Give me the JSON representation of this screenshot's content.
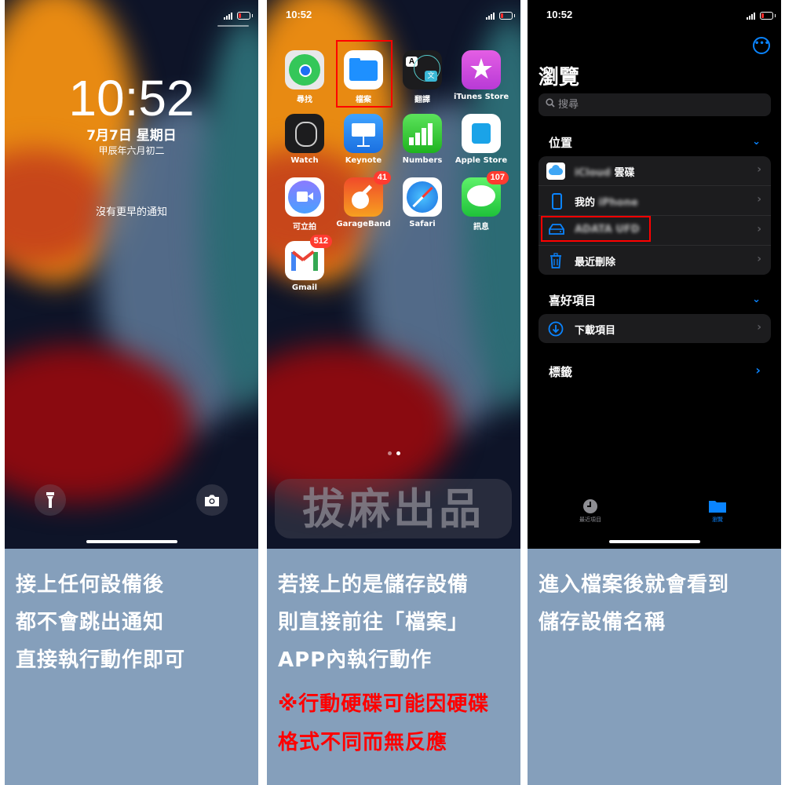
{
  "panels": [
    {
      "id": "lock-screen",
      "lock": {
        "time": "10:52",
        "date": "7月7日 星期日",
        "lunar_date": "甲辰年六月初二",
        "notification_text": "沒有更早的通知",
        "flashlight_icon": "flashlight-icon",
        "camera_icon": "camera-icon"
      },
      "caption": [
        "接上任何設備後",
        "都不會跳出通知",
        "直接執行動作即可"
      ]
    },
    {
      "id": "home-screen",
      "status_time": "10:52",
      "apps": [
        {
          "label": "尋找",
          "icon": "find-my-icon"
        },
        {
          "label": "檔案",
          "icon": "files-icon",
          "highlighted": true
        },
        {
          "label": "翻譯",
          "icon": "translate-icon"
        },
        {
          "label": "iTunes Store",
          "icon": "itunes-star-icon"
        },
        {
          "label": "Watch",
          "icon": "watch-icon"
        },
        {
          "label": "Keynote",
          "icon": "keynote-icon"
        },
        {
          "label": "Numbers",
          "icon": "numbers-icon"
        },
        {
          "label": "Apple Store",
          "icon": "apple-store-icon"
        },
        {
          "label": "可立拍",
          "icon": "clips-icon"
        },
        {
          "label": "GarageBand",
          "icon": "garageband-icon",
          "badge": "41"
        },
        {
          "label": "Safari",
          "icon": "safari-icon"
        },
        {
          "label": "訊息",
          "icon": "messages-icon",
          "badge": "107"
        },
        {
          "label": "Gmail",
          "icon": "gmail-icon",
          "badge": "512"
        }
      ],
      "page_dots": {
        "count": 2,
        "active": 2
      },
      "watermark": "拔麻出品",
      "caption": [
        "若接上的是儲存設備",
        "則直接前往「檔案」",
        "APP內執行動作"
      ],
      "caption_warning": [
        "※行動硬碟可能因硬碟",
        "格式不同而無反應"
      ]
    },
    {
      "id": "files-app",
      "status_time": "10:52",
      "title": "瀏覽",
      "search_placeholder": "搜尋",
      "sections": {
        "locations": {
          "header": "位置",
          "items": [
            {
              "label_blurred": "iCloud",
              "label": "雲碟",
              "icon": "icloud-icon"
            },
            {
              "label": "我的",
              "label_blurred": "iPhone",
              "icon": "iphone-icon"
            },
            {
              "label": "",
              "label_blurred": "ADATA UFD",
              "icon": "external-drive-icon",
              "highlighted": true
            },
            {
              "label": "最近刪除",
              "icon": "trash-icon"
            }
          ]
        },
        "favorites": {
          "header": "喜好項目",
          "items": [
            {
              "label": "下載項目",
              "icon": "download-icon"
            }
          ]
        },
        "tags": {
          "header": "標籤"
        }
      },
      "tabs": [
        {
          "label": "最近項目",
          "icon": "clock-icon",
          "active": false
        },
        {
          "label": "瀏覽",
          "icon": "folder-icon",
          "active": true
        }
      ],
      "caption": [
        "進入檔案後就會看到",
        "儲存設備名稱"
      ]
    }
  ],
  "colors": {
    "accent": "#0a84ff",
    "highlight_box": "#ff0000",
    "caption_bg": "#859fbb",
    "warning": "#ff0000",
    "badge": "#ff3b30"
  }
}
